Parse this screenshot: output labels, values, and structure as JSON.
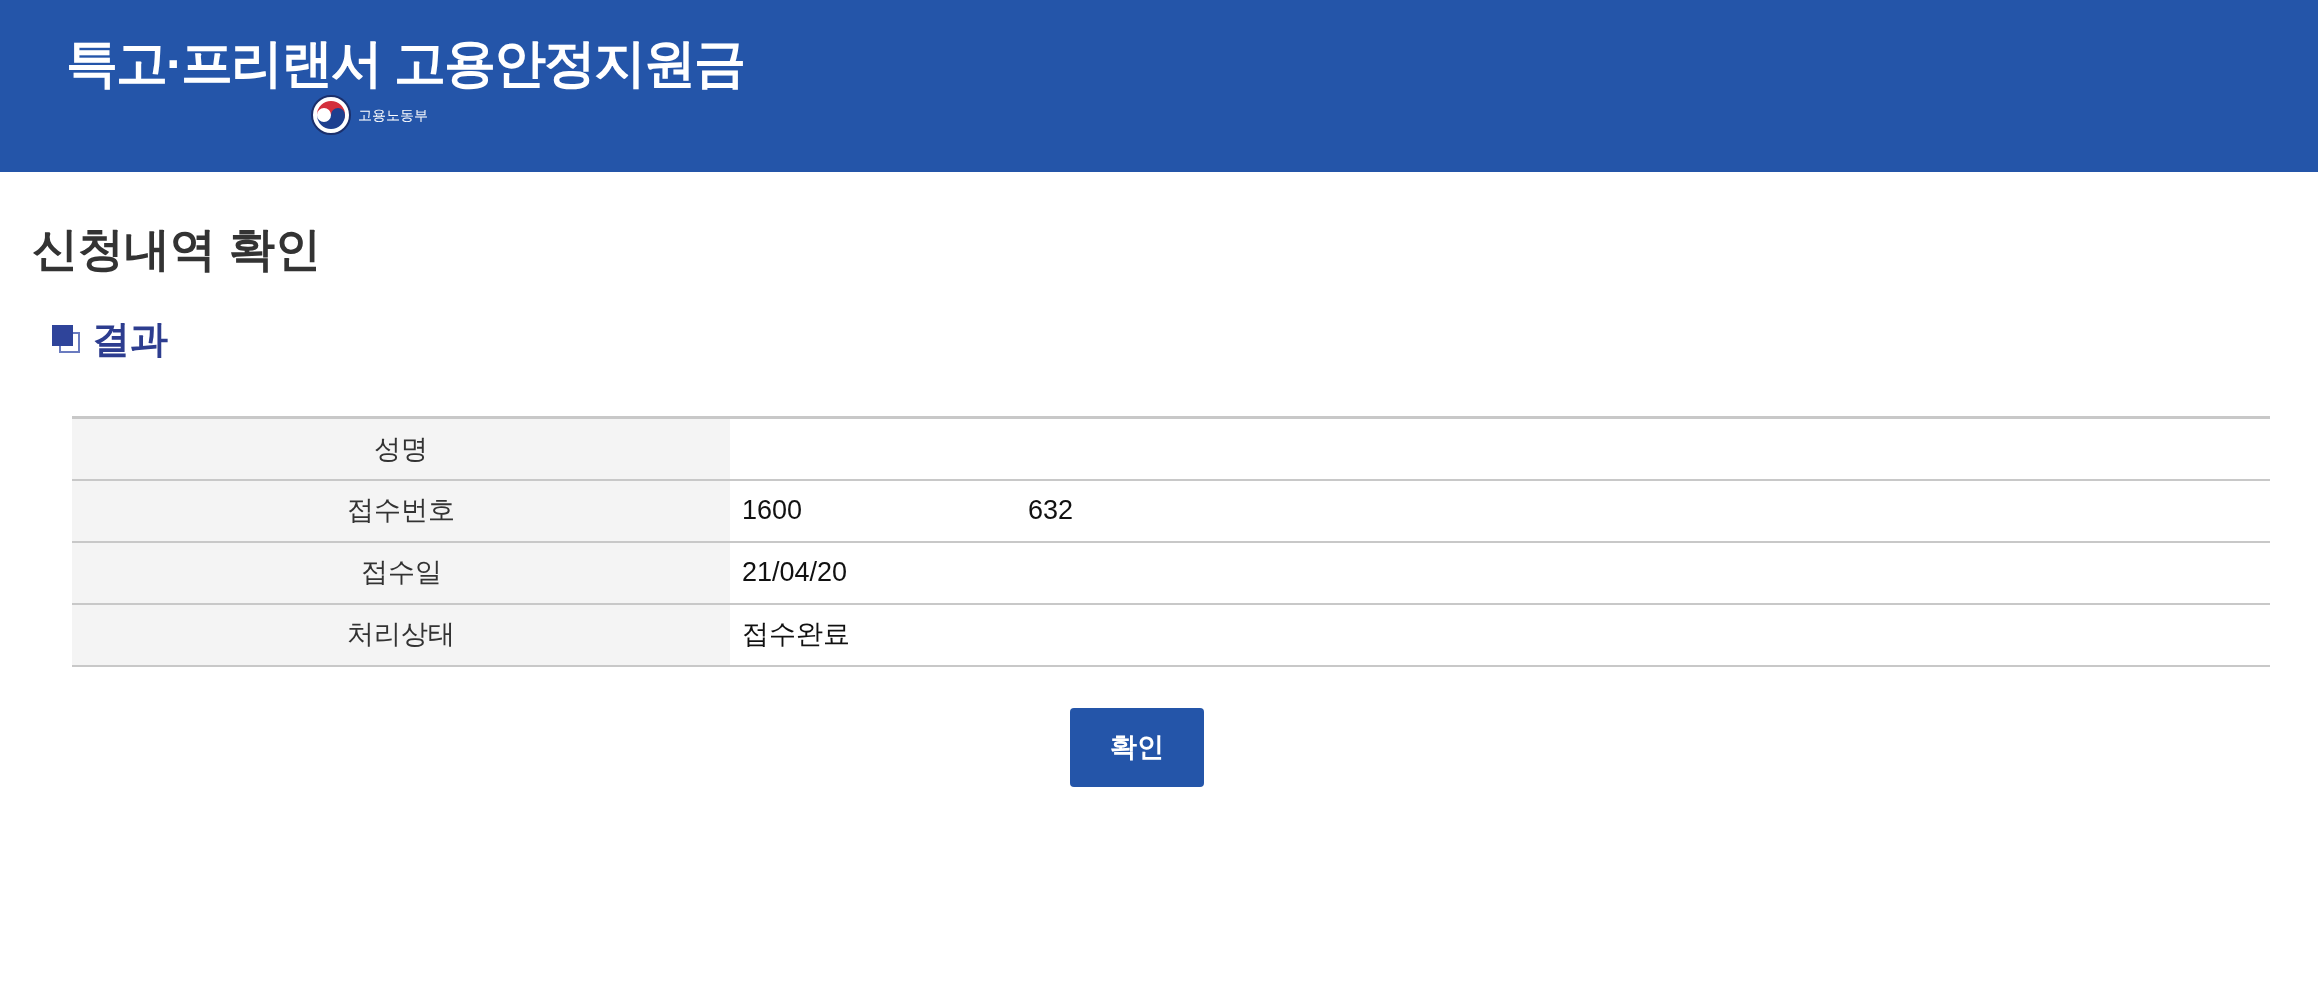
{
  "header": {
    "title": "특고·프리랜서 고용안정지원금",
    "ministry": "고용노동부"
  },
  "page_title": "신청내역 확인",
  "section": {
    "title": "결과"
  },
  "table": {
    "rows": [
      {
        "label": "성명"
      },
      {
        "label": "접수번호",
        "values": [
          "1600",
          "632"
        ]
      },
      {
        "label": "접수일",
        "values": [
          "21/04/20"
        ]
      },
      {
        "label": "처리상태",
        "values": [
          "접수완료"
        ]
      }
    ]
  },
  "confirm_button": {
    "label": "확인"
  }
}
